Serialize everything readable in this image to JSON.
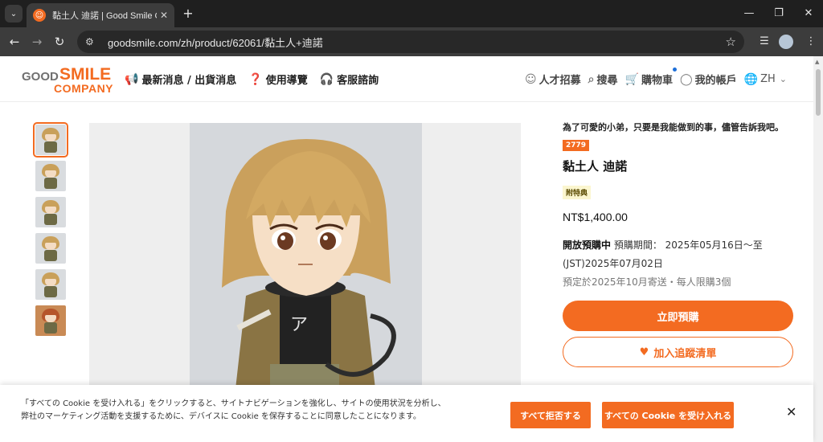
{
  "browser": {
    "tab_title": "黏土人 迪諾 | Good Smile Company",
    "url": "goodsmile.com/zh/product/62061/黏土人+迪諾",
    "new_tab": "+",
    "favicon_glyph": "☺"
  },
  "header": {
    "logo": {
      "good": "GOOD",
      "smile": "SMILE",
      "company": "COMPANY"
    },
    "main_nav": [
      {
        "label": "最新消息 / 出貨消息",
        "icon": "megaphone-icon"
      },
      {
        "label": "使用導覽",
        "icon": "guide-icon"
      },
      {
        "label": "客服諮詢",
        "icon": "headset-icon"
      }
    ],
    "right_nav": {
      "careers": "人才招募",
      "search": "搜尋",
      "cart": "購物車",
      "account": "我的帳戶",
      "language": "ZH"
    }
  },
  "product": {
    "tagline": "為了可愛的小弟，只要是我能做到的事，儘管告訴我吧。",
    "number": "2779",
    "name": "黏土人 迪諾",
    "bonus_badge": "附特典",
    "price": "NT$1,400.00",
    "preorder_status": "開放預購中",
    "preorder_period": "預購期間： 2025年05月16日～至(JST)2025年07月02日",
    "ship_note": "預定於2025年10月寄送・每人限購3個",
    "buy_button": "立即預購",
    "wishlist_button": "加入追蹤清單"
  },
  "thumbnails": 6,
  "cookie": {
    "text": "「すべての Cookie を受け入れる」をクリックすると、サイトナビゲーションを強化し、サイトの使用状況を分析し、弊社のマーケティング活動を支援するために、デバイスに Cookie を保存することに同意したことになります。",
    "reject_all": "すべて拒否する",
    "accept_all": "すべての Cookie を受け入れる",
    "close": "✕"
  },
  "colors": {
    "brand_orange": "#f36b21",
    "chrome_dark": "#1f1f1f",
    "chrome_toolbar": "#3c3c3c"
  }
}
